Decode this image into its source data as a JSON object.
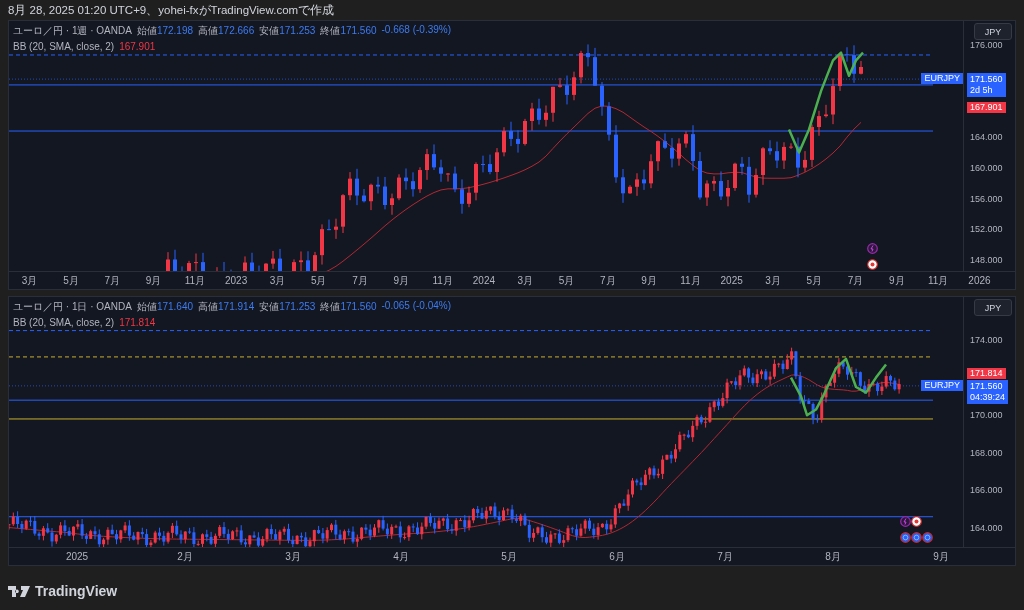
{
  "caption": "8月 28, 2025 01:20 UTC+9、yohei-fxがTradingView.comで作成",
  "panes": [
    {
      "legend": {
        "symbol": "ユーロ／円 · 1週 · OANDA",
        "ohlc": [
          {
            "label": "始値",
            "value": "172.198"
          },
          {
            "label": "高値",
            "value": "172.666"
          },
          {
            "label": "安値",
            "value": "171.253"
          },
          {
            "label": "終値",
            "value": "171.560"
          }
        ],
        "change": "-0.668 (-0.39%)",
        "indicator": "BB (20, SMA, close, 2)",
        "indicator_value": "167.901"
      },
      "currency": "JPY",
      "price_ticks": [
        "176.000",
        "164.000",
        "160.000",
        "156.000",
        "152.000",
        "148.000"
      ],
      "time_ticks": [
        "3月",
        "5月",
        "7月",
        "9月",
        "11月",
        "2023",
        "3月",
        "5月",
        "7月",
        "9月",
        "11月",
        "2024",
        "3月",
        "5月",
        "7月",
        "9月",
        "11月",
        "2025",
        "3月",
        "5月",
        "7月",
        "9月",
        "11月",
        "2026"
      ],
      "symbol_tag": "EURJPY",
      "last_price": "171.560",
      "countdown": "2d 5h",
      "band_price": "167.901"
    },
    {
      "legend": {
        "symbol": "ユーロ／円 · 1日 · OANDA",
        "ohlc": [
          {
            "label": "始値",
            "value": "171.640"
          },
          {
            "label": "高値",
            "value": "171.914"
          },
          {
            "label": "安値",
            "value": "171.253"
          },
          {
            "label": "終値",
            "value": "171.560"
          }
        ],
        "change": "-0.065 (-0.04%)",
        "indicator": "BB (20, SMA, close, 2)",
        "indicator_value": "171.814"
      },
      "currency": "JPY",
      "price_ticks": [
        "174.000",
        "170.000",
        "168.000",
        "166.000",
        "164.000"
      ],
      "time_ticks": [
        "2025",
        "2月",
        "3月",
        "4月",
        "5月",
        "6月",
        "7月",
        "8月",
        "9月"
      ],
      "symbol_tag": "EURJPY",
      "last_price": "171.560",
      "countdown": "04:39:24",
      "band_price": "171.814"
    }
  ],
  "logo": "TradingView"
}
